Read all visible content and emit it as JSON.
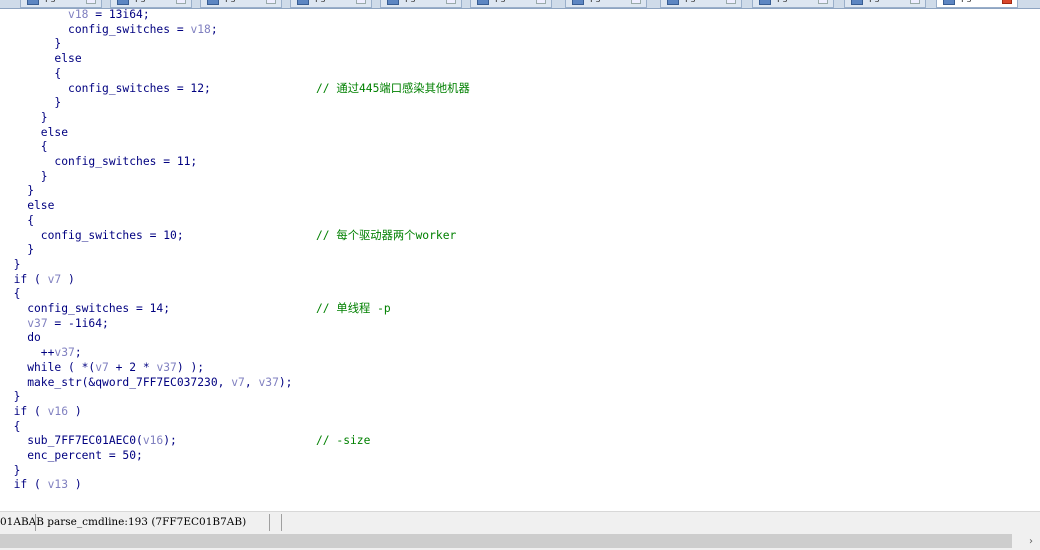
{
  "tabs": [
    {
      "label": "Ps···"
    },
    {
      "label": "Ps···"
    },
    {
      "label": "Ps···"
    },
    {
      "label": "Ps···"
    },
    {
      "label": "Ps···"
    },
    {
      "label": "Ps···"
    },
    {
      "label": "Ps···"
    },
    {
      "label": "Ps···"
    },
    {
      "label": "Ps···"
    },
    {
      "label": "Ps···"
    },
    {
      "label": "Ps···"
    }
  ],
  "code_lines": [
    [
      {
        "t": "          ",
        "c": ""
      },
      {
        "t": "v18",
        "c": "var"
      },
      {
        "t": " = 13i64;",
        "c": ""
      }
    ],
    [
      {
        "t": "          config_switches = ",
        "c": ""
      },
      {
        "t": "v18",
        "c": "var"
      },
      {
        "t": ";",
        "c": ""
      }
    ],
    [
      {
        "t": "        }",
        "c": ""
      }
    ],
    [
      {
        "t": "        else",
        "c": ""
      }
    ],
    [
      {
        "t": "        {",
        "c": ""
      }
    ],
    [
      {
        "t": "          config_switches = 12;",
        "c": ""
      }
    ],
    [
      {
        "t": "        }",
        "c": ""
      }
    ],
    [
      {
        "t": "      }",
        "c": ""
      }
    ],
    [
      {
        "t": "      else",
        "c": ""
      }
    ],
    [
      {
        "t": "      {",
        "c": ""
      }
    ],
    [
      {
        "t": "        config_switches = 11;",
        "c": ""
      }
    ],
    [
      {
        "t": "      }",
        "c": ""
      }
    ],
    [
      {
        "t": "    }",
        "c": ""
      }
    ],
    [
      {
        "t": "    else",
        "c": ""
      }
    ],
    [
      {
        "t": "    {",
        "c": ""
      }
    ],
    [
      {
        "t": "      config_switches = 10;",
        "c": ""
      }
    ],
    [
      {
        "t": "    }",
        "c": ""
      }
    ],
    [
      {
        "t": "  }",
        "c": ""
      }
    ],
    [
      {
        "t": "  if ( ",
        "c": ""
      },
      {
        "t": "v7",
        "c": "var"
      },
      {
        "t": " )",
        "c": ""
      }
    ],
    [
      {
        "t": "  {",
        "c": ""
      }
    ],
    [
      {
        "t": "    config_switches = 14;",
        "c": ""
      }
    ],
    [
      {
        "t": "    ",
        "c": ""
      },
      {
        "t": "v37",
        "c": "var"
      },
      {
        "t": " = -1i64;",
        "c": ""
      }
    ],
    [
      {
        "t": "    do",
        "c": ""
      }
    ],
    [
      {
        "t": "      ++",
        "c": ""
      },
      {
        "t": "v37",
        "c": "var"
      },
      {
        "t": ";",
        "c": ""
      }
    ],
    [
      {
        "t": "    while ( *(",
        "c": ""
      },
      {
        "t": "v7",
        "c": "var"
      },
      {
        "t": " + 2 * ",
        "c": ""
      },
      {
        "t": "v37",
        "c": "var"
      },
      {
        "t": ") );",
        "c": ""
      }
    ],
    [
      {
        "t": "    make_str(&qword_7FF7EC037230, ",
        "c": ""
      },
      {
        "t": "v7",
        "c": "var"
      },
      {
        "t": ", ",
        "c": ""
      },
      {
        "t": "v37",
        "c": "var"
      },
      {
        "t": ");",
        "c": ""
      }
    ],
    [
      {
        "t": "  }",
        "c": ""
      }
    ],
    [
      {
        "t": "  if ( ",
        "c": ""
      },
      {
        "t": "v16",
        "c": "var"
      },
      {
        "t": " )",
        "c": ""
      }
    ],
    [
      {
        "t": "  {",
        "c": ""
      }
    ],
    [
      {
        "t": "    sub_7FF7EC01AEC0(",
        "c": ""
      },
      {
        "t": "v16",
        "c": "var"
      },
      {
        "t": ");",
        "c": ""
      }
    ],
    [
      {
        "t": "    enc_percent = 50;",
        "c": ""
      }
    ],
    [
      {
        "t": "  }",
        "c": ""
      }
    ],
    [
      {
        "t": "  if ( ",
        "c": ""
      },
      {
        "t": "v13",
        "c": "var"
      },
      {
        "t": " )",
        "c": ""
      }
    ]
  ],
  "comments": [
    {
      "line": 5,
      "text": "// 通过445端口感染其他机器"
    },
    {
      "line": 15,
      "text": "// 每个驱动器两个worker"
    },
    {
      "line": 20,
      "text": "// 单线程 -p"
    },
    {
      "line": 29,
      "text": "// -size"
    }
  ],
  "status": {
    "text": "01ABAB parse_cmdline:193 (7FF7EC01B7AB)"
  },
  "scroll": {
    "right_arrow": "›"
  },
  "colors": {
    "keyword": "#000080",
    "variable": "#8080c0",
    "comment": "#008000"
  }
}
